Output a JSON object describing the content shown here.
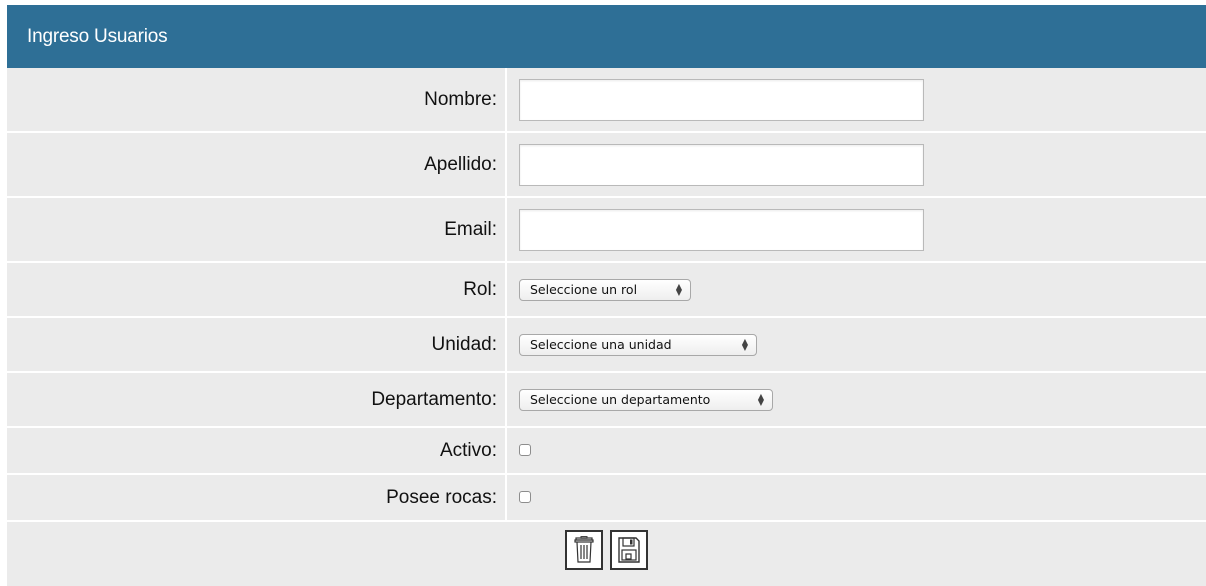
{
  "header": {
    "title": "Ingreso Usuarios"
  },
  "form": {
    "nombre": {
      "label": "Nombre:",
      "value": ""
    },
    "apellido": {
      "label": "Apellido:",
      "value": ""
    },
    "email": {
      "label": "Email:",
      "value": ""
    },
    "rol": {
      "label": "Rol:",
      "selected": "Seleccione un rol"
    },
    "unidad": {
      "label": "Unidad:",
      "selected": "Seleccione una unidad"
    },
    "departamento": {
      "label": "Departamento:",
      "selected": "Seleccione un departamento"
    },
    "activo": {
      "label": "Activo:",
      "checked": false
    },
    "posee_rocas": {
      "label": "Posee rocas:",
      "checked": false
    }
  },
  "actions": {
    "delete_icon": "trash-icon",
    "save_icon": "floppy-disk-icon"
  },
  "colors": {
    "header_bg": "#2e6f96",
    "panel_bg": "#ebebeb"
  }
}
